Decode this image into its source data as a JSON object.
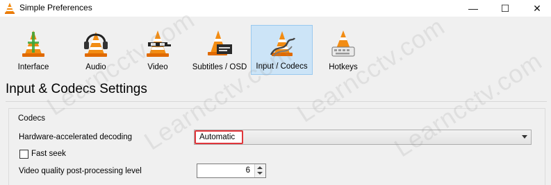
{
  "window": {
    "title": "Simple Preferences",
    "controls": {
      "minimize": "—",
      "maximize": "☐",
      "close": "✕"
    }
  },
  "toolbar": {
    "items": [
      {
        "label": "Interface",
        "icon": "vlc-cone-interface-icon",
        "active": false
      },
      {
        "label": "Audio",
        "icon": "vlc-cone-headphones-icon",
        "active": false
      },
      {
        "label": "Video",
        "icon": "vlc-cone-glasses-icon",
        "active": false
      },
      {
        "label": "Subtitles / OSD",
        "icon": "vlc-cone-subtitles-icon",
        "active": false
      },
      {
        "label": "Input / Codecs",
        "icon": "vlc-cone-codecs-icon",
        "active": true
      },
      {
        "label": "Hotkeys",
        "icon": "vlc-cone-keyboard-icon",
        "active": false
      }
    ]
  },
  "section": {
    "heading": "Input & Codecs Settings"
  },
  "codecs": {
    "group_title": "Codecs",
    "hw_decoding": {
      "label": "Hardware-accelerated decoding",
      "value": "Automatic"
    },
    "fast_seek": {
      "label": "Fast seek",
      "checked": false
    },
    "postproc": {
      "label": "Video quality post-processing level",
      "value": "6"
    }
  },
  "watermark": {
    "text": "Learncctv.com"
  },
  "colors": {
    "highlight": "#e0363b",
    "active_tab_bg": "#cce4f7",
    "cone_orange": "#f28c13"
  }
}
